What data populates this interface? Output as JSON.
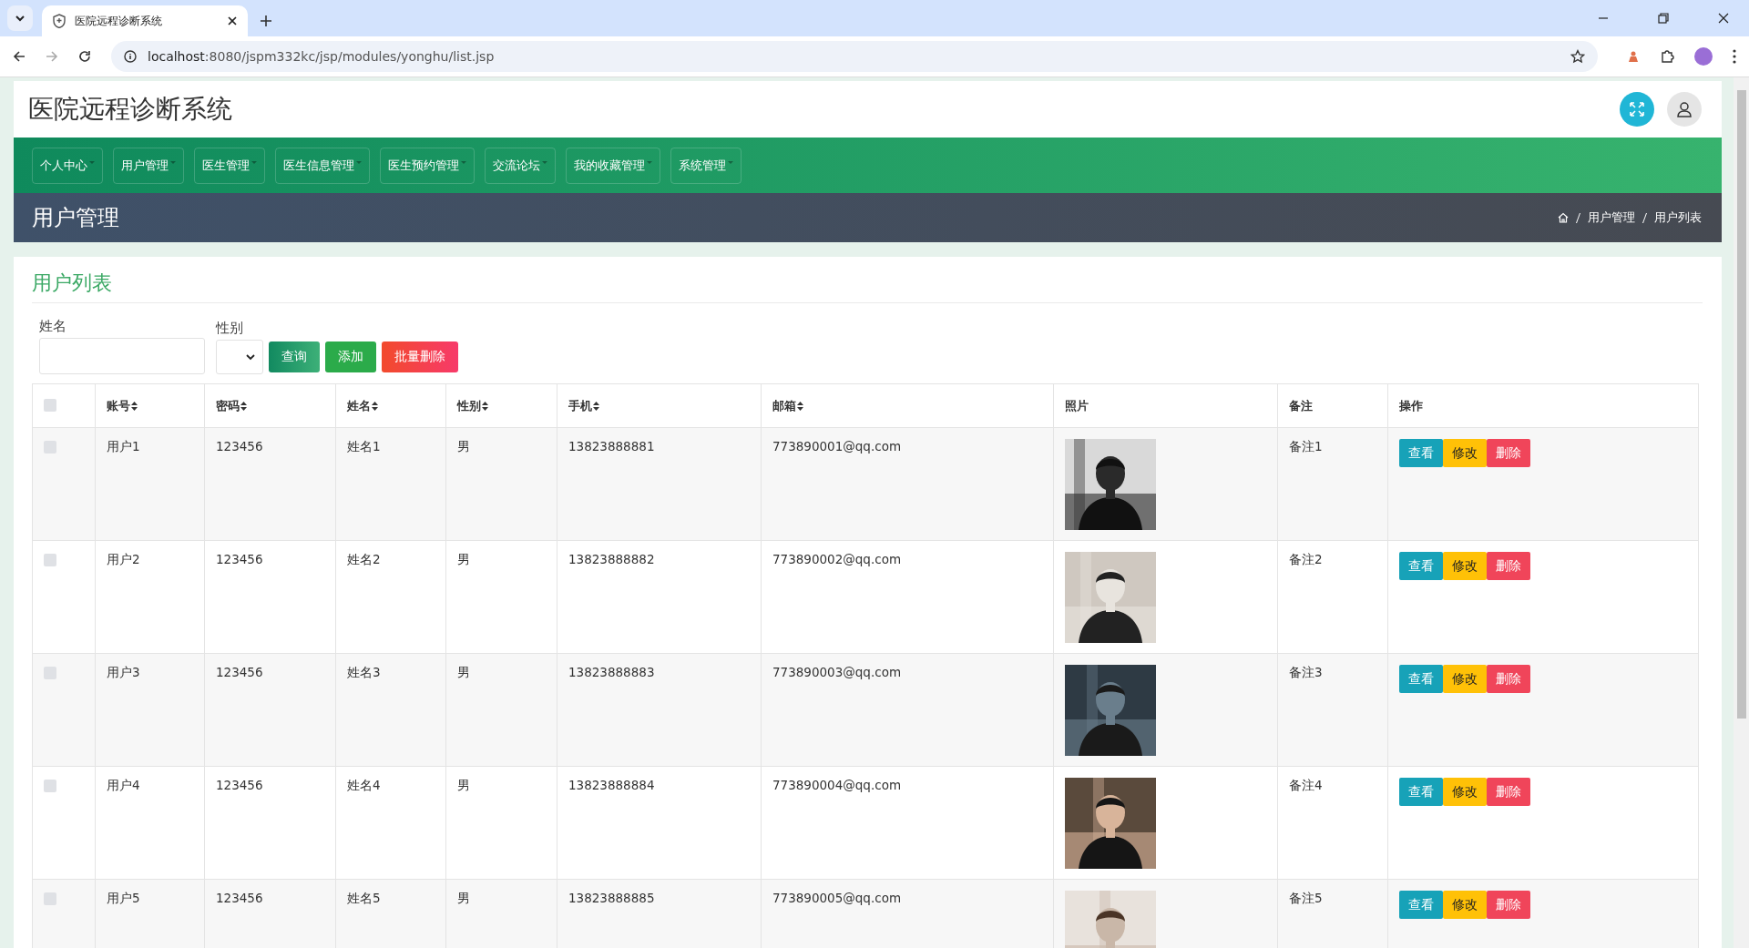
{
  "browser": {
    "tab_title": "医院远程诊断系统",
    "url_host": "localhost",
    "url_rest": ":8080/jspm332kc/jsp/modules/yonghu/list.jsp"
  },
  "header": {
    "title": "医院远程诊断系统"
  },
  "nav": [
    {
      "label": "个人中心"
    },
    {
      "label": "用户管理"
    },
    {
      "label": "医生管理"
    },
    {
      "label": "医生信息管理"
    },
    {
      "label": "医生预约管理"
    },
    {
      "label": "交流论坛"
    },
    {
      "label": "我的收藏管理"
    },
    {
      "label": "系统管理"
    }
  ],
  "banner": {
    "title": "用户管理",
    "breadcrumb": [
      "用户管理",
      "用户列表"
    ]
  },
  "card": {
    "title": "用户列表"
  },
  "filters": [
    {
      "kind": "text",
      "label": "姓名"
    },
    {
      "kind": "select",
      "label": "性别"
    }
  ],
  "actions": [
    {
      "label": "查询",
      "kind": "search"
    },
    {
      "label": "添加",
      "kind": "add"
    },
    {
      "label": "批量删除",
      "kind": "delete"
    }
  ],
  "table": {
    "select_all": {
      "checked": false
    },
    "columns": [
      {
        "label": "账号",
        "sortable": true
      },
      {
        "label": "密码",
        "sortable": true
      },
      {
        "label": "姓名",
        "sortable": true
      },
      {
        "label": "性别",
        "sortable": true
      },
      {
        "label": "手机",
        "sortable": true
      },
      {
        "label": "邮箱",
        "sortable": true
      },
      {
        "label": "照片",
        "sortable": false
      },
      {
        "label": "备注",
        "sortable": false
      },
      {
        "label": "操作",
        "sortable": false
      }
    ],
    "rows": [
      {
        "checked": false,
        "cells": [
          "用户1",
          "123456",
          "姓名1",
          "男",
          "13823888881",
          "773890001@qq.com",
          {
            "kind": "picture"
          },
          "备注1"
        ],
        "buttons": [
          {
            "label": "查看",
            "kind": "view"
          },
          {
            "label": "修改",
            "kind": "edit"
          },
          {
            "label": "删除",
            "kind": "delete"
          }
        ]
      },
      {
        "checked": false,
        "cells": [
          "用户2",
          "123456",
          "姓名2",
          "男",
          "13823888882",
          "773890002@qq.com",
          {
            "kind": "picture"
          },
          "备注2"
        ],
        "buttons": [
          {
            "label": "查看",
            "kind": "view"
          },
          {
            "label": "修改",
            "kind": "edit"
          },
          {
            "label": "删除",
            "kind": "delete"
          }
        ]
      },
      {
        "checked": false,
        "cells": [
          "用户3",
          "123456",
          "姓名3",
          "男",
          "13823888883",
          "773890003@qq.com",
          {
            "kind": "picture"
          },
          "备注3"
        ],
        "buttons": [
          {
            "label": "查看",
            "kind": "view"
          },
          {
            "label": "修改",
            "kind": "edit"
          },
          {
            "label": "删除",
            "kind": "delete"
          }
        ]
      },
      {
        "checked": false,
        "cells": [
          "用户4",
          "123456",
          "姓名4",
          "男",
          "13823888884",
          "773890004@qq.com",
          {
            "kind": "picture"
          },
          "备注4"
        ],
        "buttons": [
          {
            "label": "查看",
            "kind": "view"
          },
          {
            "label": "修改",
            "kind": "edit"
          },
          {
            "label": "删除",
            "kind": "delete"
          }
        ]
      },
      {
        "checked": false,
        "cells": [
          "用户5",
          "123456",
          "姓名5",
          "男",
          "13823888885",
          "773890005@qq.com",
          {
            "kind": "picture"
          },
          "备注5"
        ],
        "buttons": [
          {
            "label": "查看",
            "kind": "view"
          },
          {
            "label": "修改",
            "kind": "edit"
          },
          {
            "label": "删除",
            "kind": "delete"
          }
        ]
      }
    ]
  }
}
